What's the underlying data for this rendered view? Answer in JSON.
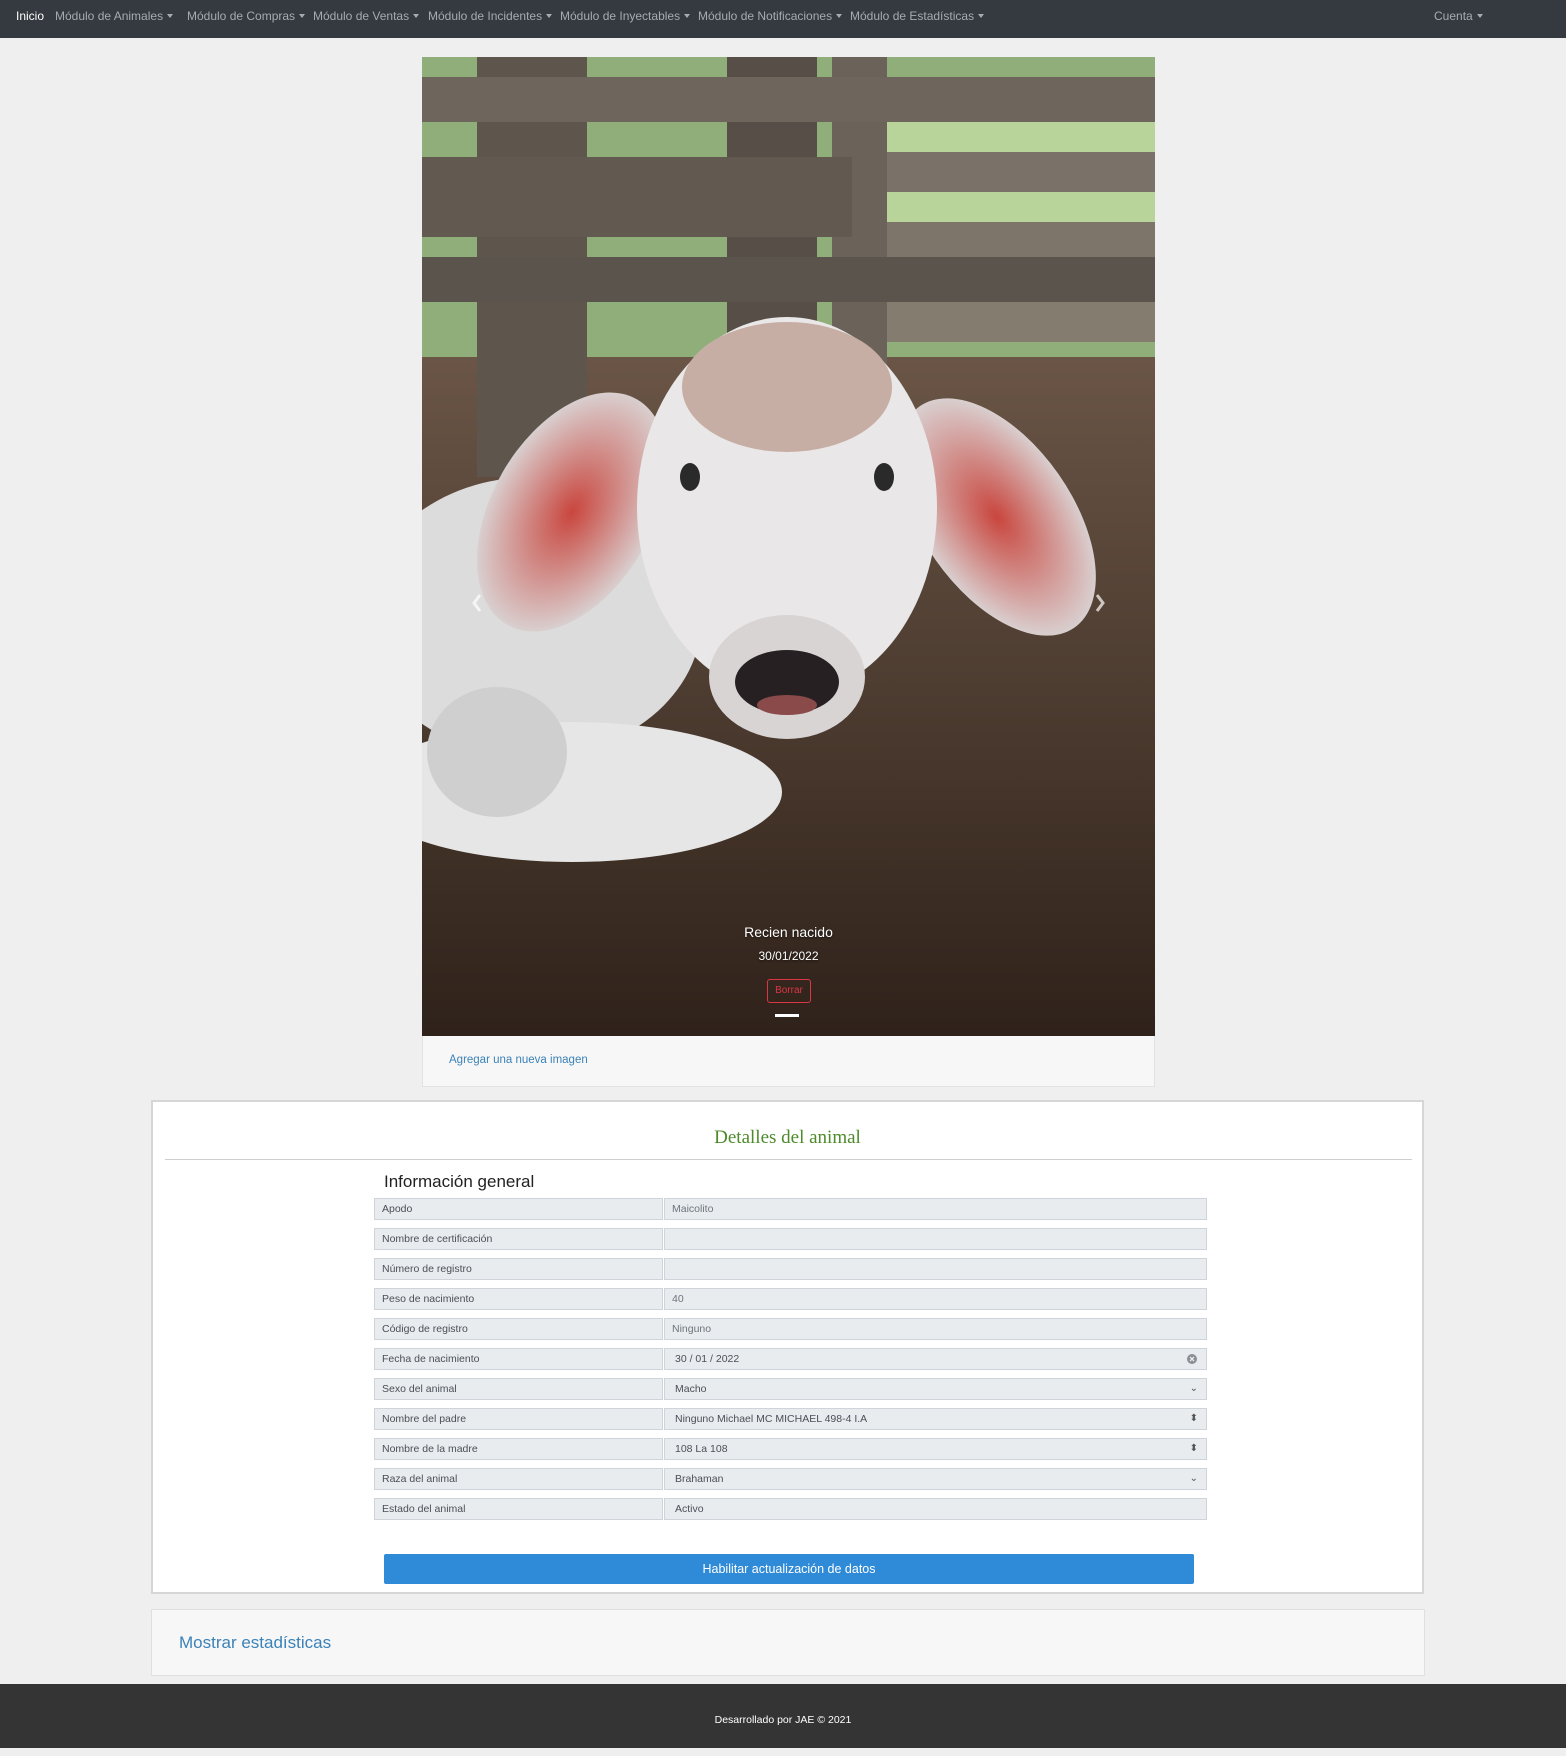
{
  "navbar": {
    "items": [
      {
        "label": "Inicio",
        "dropdown": false
      },
      {
        "label": "Módulo de Animales",
        "dropdown": true
      },
      {
        "label": "Módulo de Compras",
        "dropdown": true
      },
      {
        "label": "Módulo de Ventas",
        "dropdown": true
      },
      {
        "label": "Módulo de Incidentes",
        "dropdown": true
      },
      {
        "label": "Módulo de Inyectables",
        "dropdown": true
      },
      {
        "label": "Módulo de Notificaciones",
        "dropdown": true
      },
      {
        "label": "Módulo de Estadísticas",
        "dropdown": true
      }
    ],
    "account_label": "Cuenta"
  },
  "carousel": {
    "caption_title": "Recien nacido",
    "caption_date": "30/01/2022",
    "delete_label": "Borrar",
    "add_image_link": "Agregar una nueva imagen",
    "prev_icon": "chevron-left-icon",
    "next_icon": "chevron-right-icon"
  },
  "details": {
    "title": "Detalles del animal",
    "section_title": "Información general",
    "fields": [
      {
        "label": "Apodo",
        "value": "Maicolito"
      },
      {
        "label": "Nombre de certificación",
        "value": ""
      },
      {
        "label": "Número de registro",
        "value": ""
      },
      {
        "label": "Peso de nacimiento",
        "value": "40"
      },
      {
        "label": "Código de registro",
        "value": "Ninguno"
      },
      {
        "label": "Fecha de nacimiento",
        "value": "30 / 01 / 2022"
      },
      {
        "label": "Sexo del animal",
        "value": "Macho"
      },
      {
        "label": "Nombre del padre",
        "value": "Ninguno Michael MC MICHAEL 498-4 I.A"
      },
      {
        "label": "Nombre de la madre",
        "value": "108 La 108"
      },
      {
        "label": "Raza del animal",
        "value": "Brahaman"
      },
      {
        "label": "Estado del animal",
        "value": "Activo"
      }
    ],
    "enable_button": "Habilitar actualización de datos"
  },
  "stats_link": "Mostrar estadísticas",
  "footer_text": "Desarrollado por JAE © 2021",
  "colors": {
    "navbar_bg": "#343a40",
    "primary_button": "#2f8ad8",
    "title_green": "#4d8a2a",
    "link_blue": "#3b82b7",
    "danger": "#dc3545",
    "footer_bg": "#343434"
  }
}
